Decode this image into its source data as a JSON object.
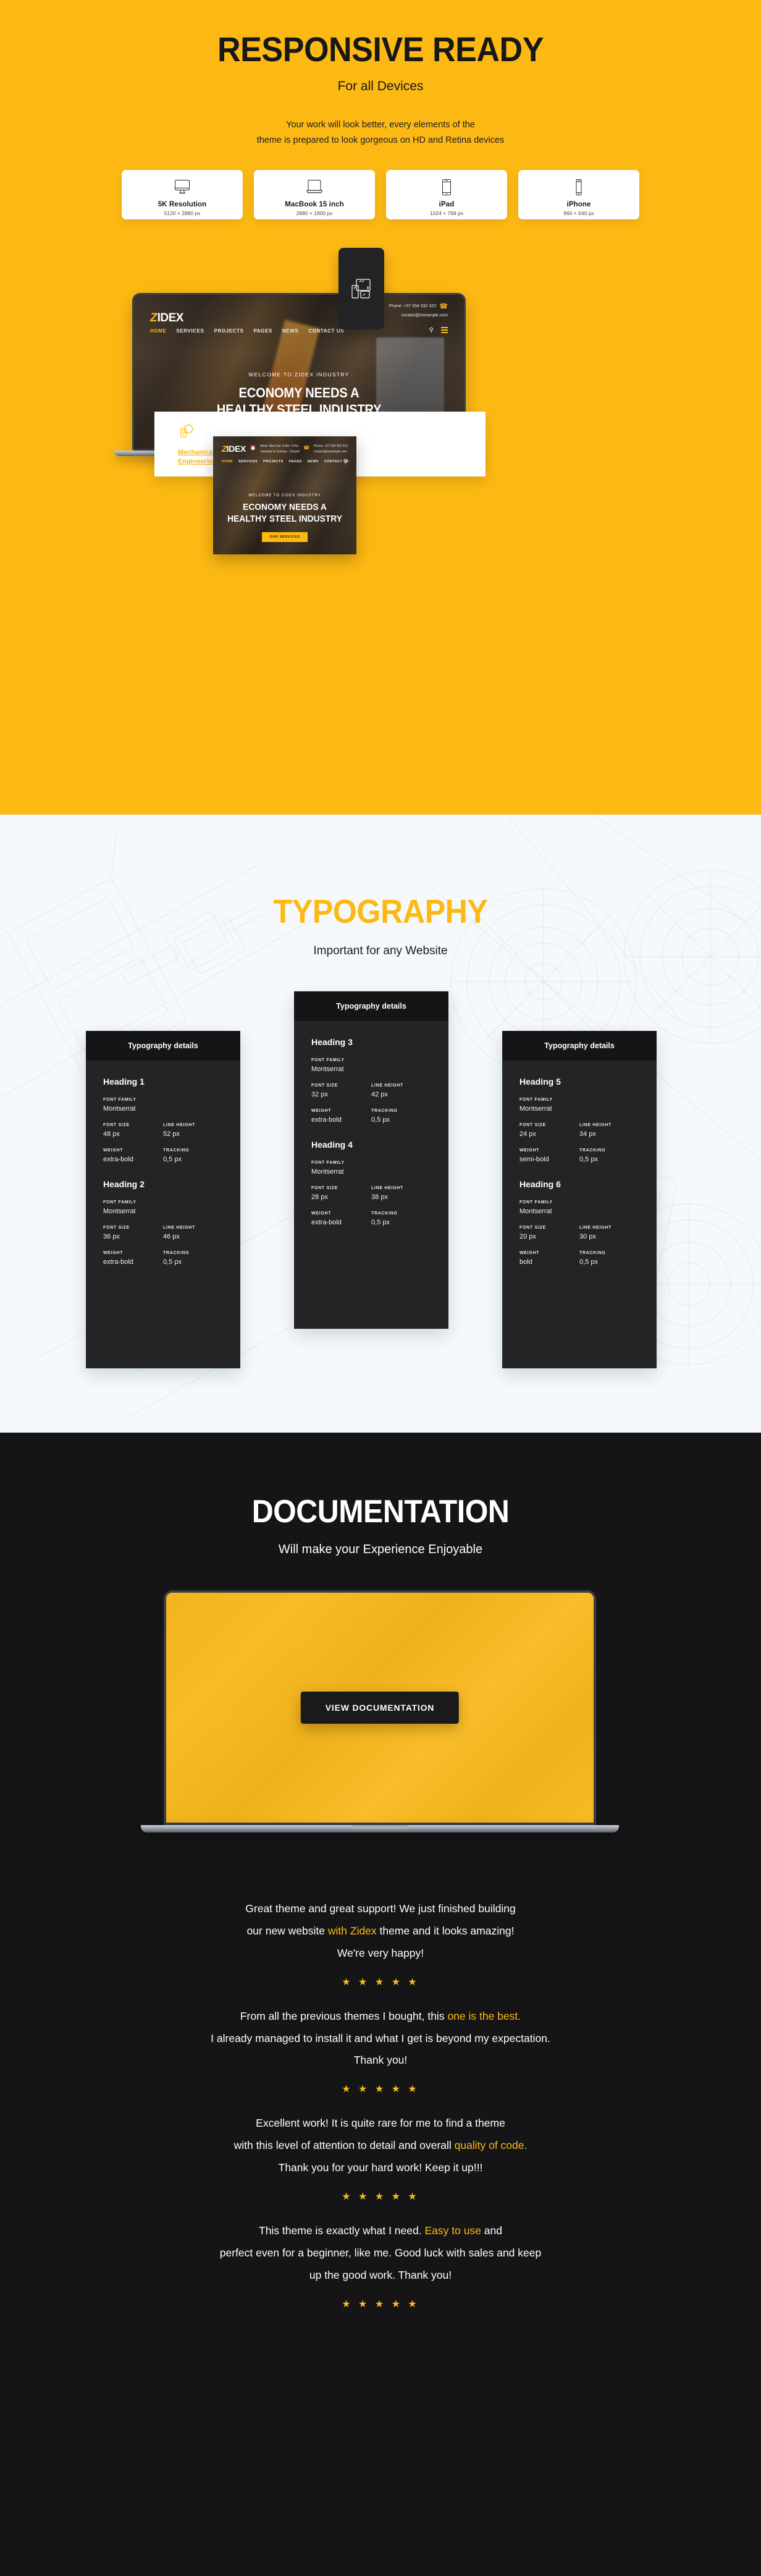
{
  "responsive": {
    "title": "RESPONSIVE READY",
    "subtitle": "For all Devices",
    "desc_line1": "Your work will look better, every elements of the",
    "desc_line2": "theme is prepared to look gorgeous on HD and Retina devices",
    "devices": [
      {
        "icon": "imac-monitor-icon",
        "name": "5K Resolution",
        "resolution": "5120 × 2880 px"
      },
      {
        "icon": "macbook-laptop-icon",
        "name": "MacBook 15 inch",
        "resolution": "2880 × 1800 px"
      },
      {
        "icon": "ipad-tablet-icon",
        "name": "iPad",
        "resolution": "1024 × 768 px"
      },
      {
        "icon": "iphone-phone-icon",
        "name": "iPhone",
        "resolution": "960 × 640 px"
      }
    ],
    "mockup": {
      "logo_z": "Z",
      "logo_rest": "IDEX",
      "phone_label": "Phone: +07 554 332 322",
      "email_label": "contact@exeample.com",
      "nav": [
        "HOME",
        "SERVICES",
        "PROJECTS",
        "PAGES",
        "NEWS",
        "CONTACT US"
      ],
      "hero_kicker": "WELCOME TO ZIDEX INDUSTRY",
      "hero_line1": "ECONOMY NEEDS A",
      "hero_line2": "HEALTHY STEEL INDUSTRY",
      "hero_button": "OUR SERVICES",
      "service_title_line1": "Mechanical",
      "service_title_line2": "Engineering",
      "work_hours_line1": "Work: Mon-Sat. 8 Am- 5 Pm",
      "work_hours_line2": "Saturday & Sunday - Closed"
    }
  },
  "typography": {
    "title": "TYPOGRAPHY",
    "subtitle": "Important for any Website",
    "card_header": "Typography details",
    "labels": {
      "font_family": "FONT FAMILY",
      "font_size": "FONT SIZE",
      "line_height": "LINE HEIGHT",
      "weight": "WEIGHT",
      "tracking": "TRACKING"
    },
    "cards": [
      {
        "entries": [
          {
            "heading": "Heading 1",
            "font_family": "Montserrat",
            "font_size": "48 px",
            "line_height": "52 px",
            "weight": "extra-bold",
            "tracking": "0,5 px"
          },
          {
            "heading": "Heading 2",
            "font_family": "Montserrat",
            "font_size": "36 px",
            "line_height": "46 px",
            "weight": "extra-bold",
            "tracking": "0,5 px"
          }
        ]
      },
      {
        "entries": [
          {
            "heading": "Heading 3",
            "font_family": "Montserrat",
            "font_size": "32 px",
            "line_height": "42 px",
            "weight": "extra-bold",
            "tracking": "0,5 px"
          },
          {
            "heading": "Heading 4",
            "font_family": "Montserrat",
            "font_size": "28 px",
            "line_height": "38 px",
            "weight": "extra-bold",
            "tracking": "0,5 px"
          }
        ]
      },
      {
        "entries": [
          {
            "heading": "Heading 5",
            "font_family": "Montserrat",
            "font_size": "24 px",
            "line_height": "34 px",
            "weight": "semi-bold",
            "tracking": "0,5 px"
          },
          {
            "heading": "Heading 6",
            "font_family": "Montserrat",
            "font_size": "20 px",
            "line_height": "30 px",
            "weight": "bold",
            "tracking": "0,5 px"
          }
        ]
      }
    ]
  },
  "documentation": {
    "title": "DOCUMENTATION",
    "subtitle": "Will make your Experience Enjoyable",
    "button": "VIEW DOCUMENTATION",
    "stars": "★ ★ ★ ★ ★",
    "testimonials": [
      {
        "l1_a": "Great theme and great support! We just finished building",
        "l2_a": "our new website ",
        "l2_hl": "with Zidex",
        "l2_b": " theme and it looks amazing!",
        "l3_a": "We're very happy!"
      },
      {
        "l1_a": "From all the previous themes I bought, this ",
        "l1_hl": "one is the best.",
        "l1_b": "",
        "l2_a": "I already managed to install it and what I get is beyond my expectation.",
        "l3_a": "Thank you!"
      },
      {
        "l1_a": "Excellent work! It is quite rare for me to find a theme",
        "l2_a": "with this level of attention to detail and overall ",
        "l2_hl": "quality of code.",
        "l2_b": "",
        "l3_a": "Thank you for your hard work! Keep it up!!!"
      },
      {
        "l1_a": "This theme is exactly what I need. ",
        "l1_hl": "Easy to use",
        "l1_b": " and",
        "l2_a": "perfect even for a beginner, like me. Good luck with sales and keep",
        "l3_a": "up the good work. Thank you!"
      }
    ]
  },
  "colors": {
    "brand_yellow": "#FDB913",
    "dark": "#151517",
    "card_dark": "#242426",
    "blueprint_bg": "#F5F9FC"
  }
}
